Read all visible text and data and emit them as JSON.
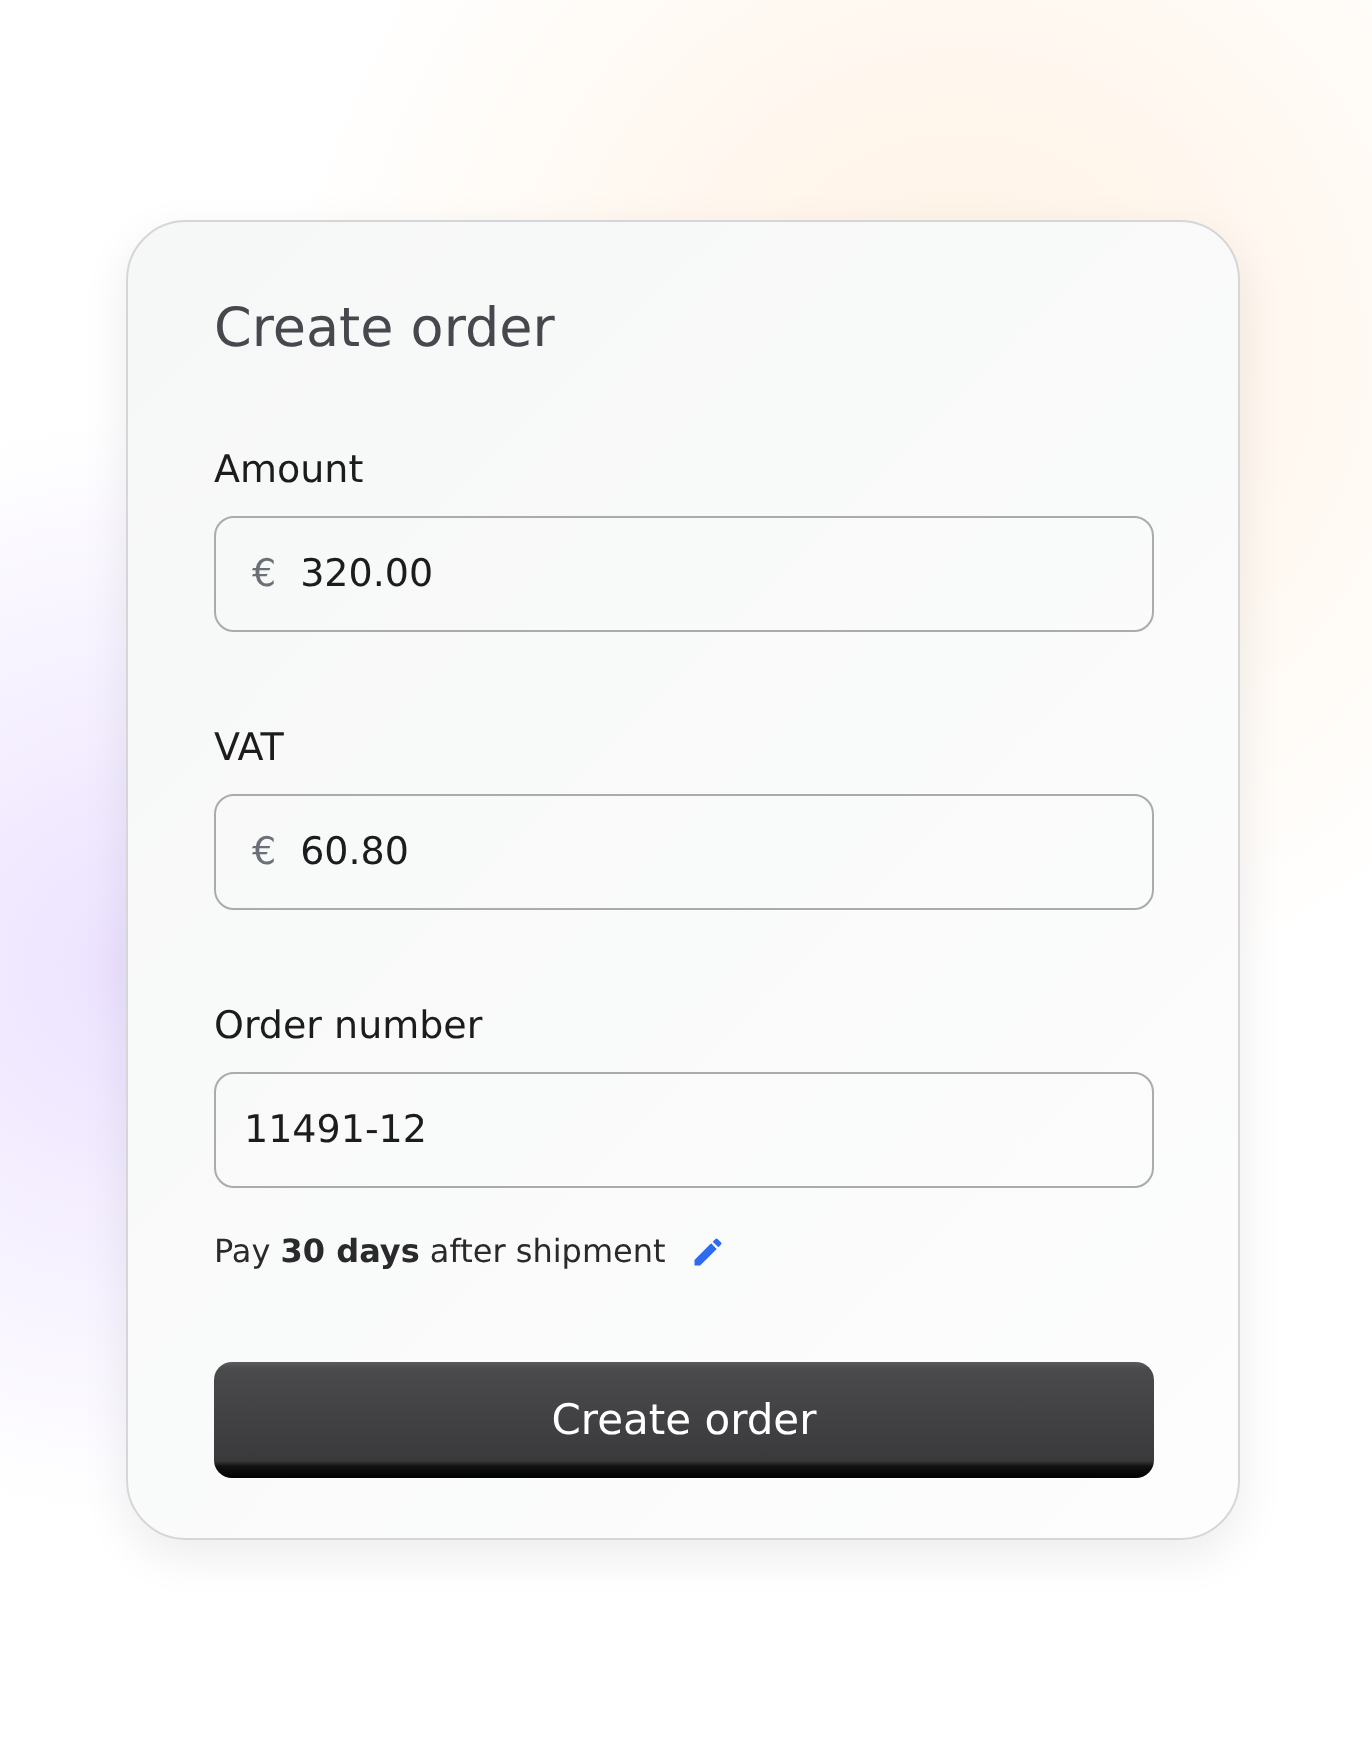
{
  "title": "Create order",
  "fields": [
    {
      "label": "Amount",
      "prefix": "€",
      "value": "320.00"
    },
    {
      "label": "VAT",
      "prefix": "€",
      "value": "60.80"
    },
    {
      "label": "Order number",
      "value": "11491-12"
    }
  ],
  "payment_note": "Pay **30 days** after shipment",
  "submit_button": "Create order"
}
